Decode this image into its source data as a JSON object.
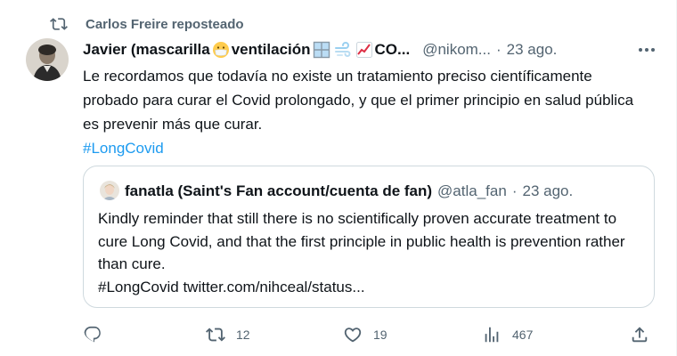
{
  "retweet": {
    "label": "Carlos Freire reposteado"
  },
  "tweet": {
    "author_name": "Javier (mascarilla",
    "author_name_mid": " ventilación ",
    "author_name_tail": "CO...",
    "handle": "@nikom...",
    "dot": "·",
    "time": "23 ago.",
    "text": "Le recordamos que todavía no existe un tratamiento preciso científicamente probado para curar el Covid prolongado, y que el primer principio en salud pública es prevenir más que curar.",
    "hashtag": "#LongCovid"
  },
  "quote": {
    "name": "fanatla (Saint's Fan account/cuenta de fan)",
    "handle": "@atla_fan",
    "dot": "·",
    "time": "23 ago.",
    "text": "Kindly reminder that still there is no scientifically proven accurate treatment to cure Long Covid, and that the first principle in public health is prevention rather than cure.",
    "link_text": "#LongCovid twitter.com/nihceal/status..."
  },
  "actions": {
    "reply_count": "",
    "retweet_count": "12",
    "like_count": "19",
    "views_count": "467"
  },
  "colors": {
    "accent": "#1d9bf0",
    "secondary_text": "#536471",
    "border": "#cfd9de"
  },
  "icons": {
    "retweet": "retweet-icon",
    "more": "more-icon",
    "reply": "reply-icon",
    "like": "heart-icon",
    "views": "views-icon",
    "share": "share-icon"
  }
}
